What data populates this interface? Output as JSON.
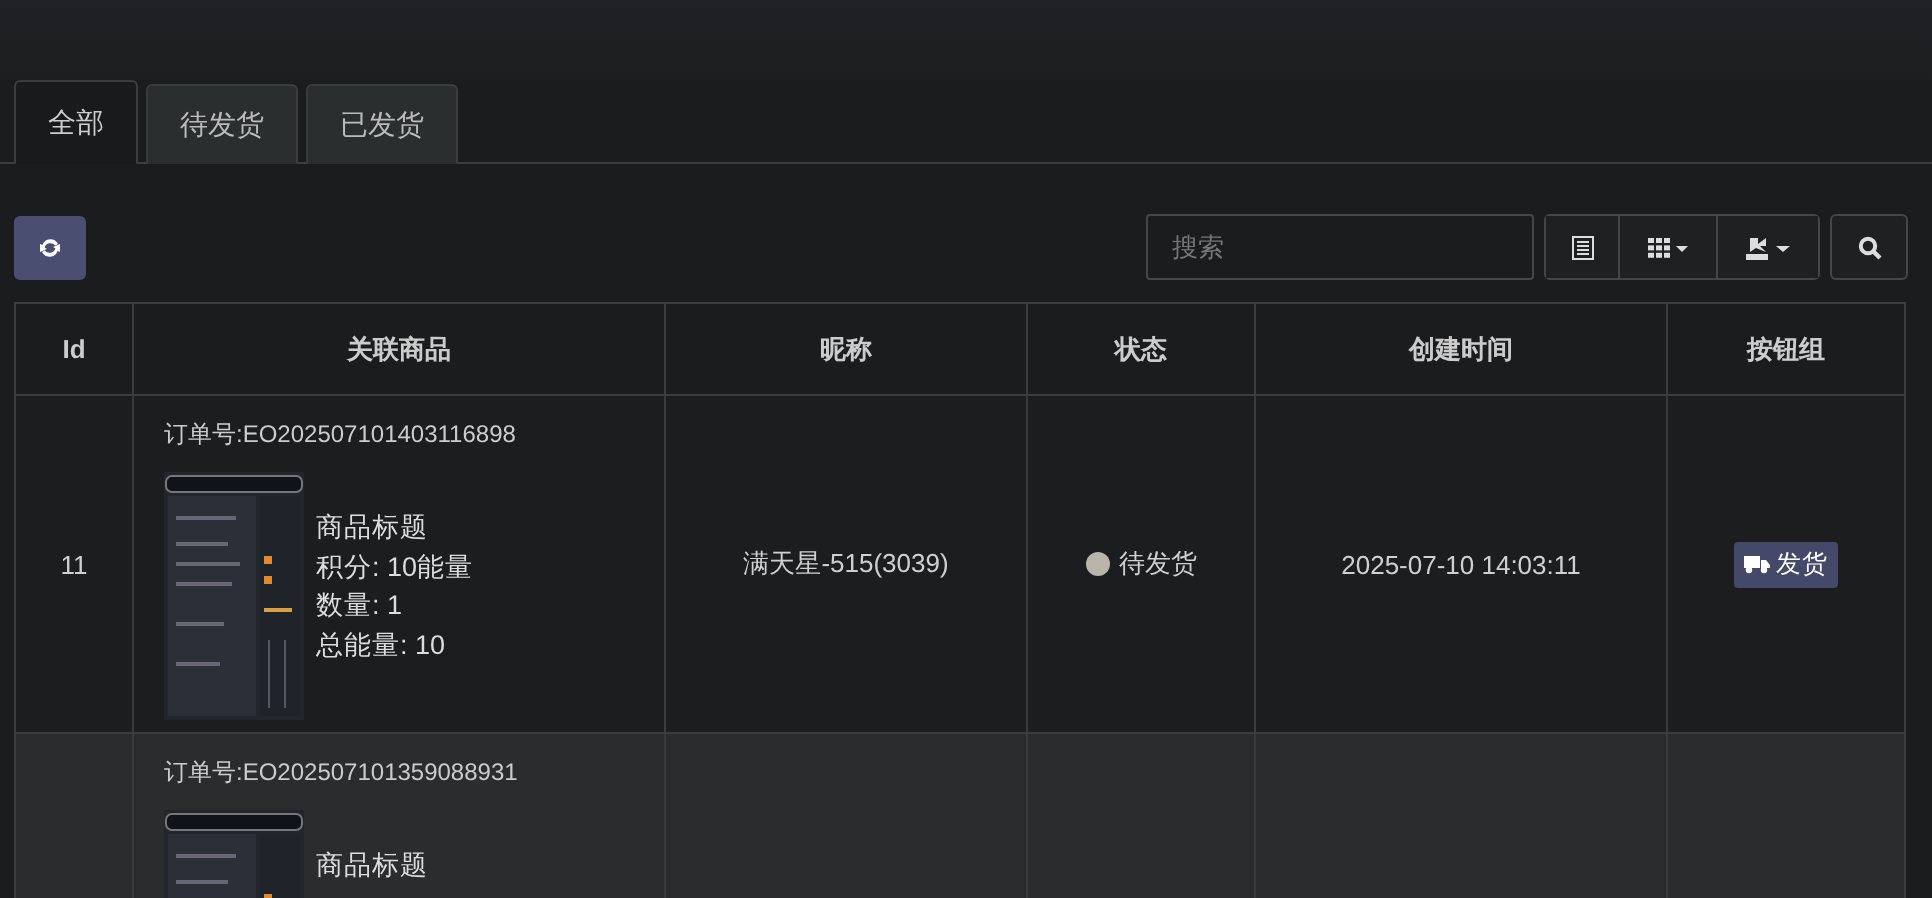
{
  "tabs": [
    {
      "label": "全部",
      "selected": true
    },
    {
      "label": "待发货",
      "selected": false
    },
    {
      "label": "已发货",
      "selected": false
    }
  ],
  "search": {
    "placeholder": "搜索"
  },
  "table": {
    "columns": [
      "Id",
      "关联商品",
      "昵称",
      "状态",
      "创建时间",
      "按钮组"
    ],
    "rows": [
      {
        "id": "11",
        "order_no": "订单号:EO202507101403116898",
        "product_lines": [
          "商品标题",
          "积分: 10能量",
          "数量: 1",
          "总能量: 10"
        ],
        "nickname": "满天星-515(3039)",
        "status": "待发货",
        "created": "2025-07-10 14:03:11",
        "action": "发货",
        "selected": false
      },
      {
        "order_no": "订单号:EO202507101359088931",
        "product_lines": [
          "商品标题"
        ],
        "selected": true
      }
    ]
  }
}
